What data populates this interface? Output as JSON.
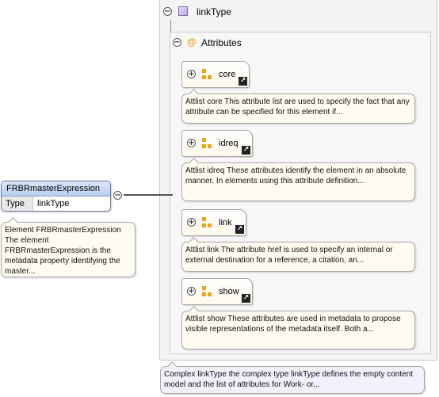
{
  "root_element": {
    "name": "FRBRmasterExpression",
    "type_key": "Type",
    "type_value": "linkType",
    "doc": "Element FRBRmasterExpression The element FRBRmasterExpression is the metadata property identifying the master..."
  },
  "complex_type": {
    "title": "linkType",
    "collapse_symbol": "−",
    "doc": "Complex linkType the complex type linkType defines the empty content model and the list of attributes for Work- or..."
  },
  "attributes": {
    "at_symbol": "@",
    "title": "Attributes",
    "collapse_symbol": "−"
  },
  "groups": [
    {
      "label": "core",
      "expand_symbol": "+",
      "ref_symbol": "↗",
      "doc": "Attlist core This attribute list are used to specify the fact that any attribute can be specified for this element if..."
    },
    {
      "label": "idreq",
      "expand_symbol": "+",
      "ref_symbol": "↗",
      "doc": "Attlist idreq These attributes identify the element in an absolute manner. In elements using this attribute definition..."
    },
    {
      "label": "link",
      "expand_symbol": "+",
      "ref_symbol": "↗",
      "doc": "Attlist link The attribute href is used to specify an internal or external destination for a reference, a citation, an..."
    },
    {
      "label": "show",
      "expand_symbol": "+",
      "ref_symbol": "↗",
      "doc": "Attlist show These attributes are used in metadata to propose visible representations of the metadata itself. Both a..."
    }
  ]
}
